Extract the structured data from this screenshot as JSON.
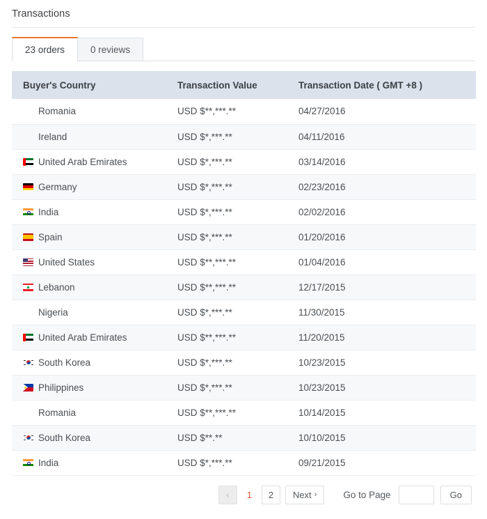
{
  "panel": {
    "title": "Transactions"
  },
  "tabs": [
    {
      "label": "23 orders",
      "active": true
    },
    {
      "label": "0 reviews",
      "active": false
    }
  ],
  "table": {
    "columns": [
      "Buyer's Country",
      "Transaction Value",
      "Transaction Date ( GMT +8 )"
    ],
    "rows": [
      {
        "flag": "ro",
        "country": "Romania",
        "value": "USD $**,***.**",
        "date": "04/27/2016"
      },
      {
        "flag": "ie",
        "country": "Ireland",
        "value": "USD $*,***.**",
        "date": "04/11/2016"
      },
      {
        "flag": "ae",
        "country": "United Arab Emirates",
        "value": "USD $*,***.**",
        "date": "03/14/2016"
      },
      {
        "flag": "de",
        "country": "Germany",
        "value": "USD $*,***.**",
        "date": "02/23/2016"
      },
      {
        "flag": "in",
        "country": "India",
        "value": "USD $*,***.**",
        "date": "02/02/2016"
      },
      {
        "flag": "es",
        "country": "Spain",
        "value": "USD $*,***.**",
        "date": "01/20/2016"
      },
      {
        "flag": "us",
        "country": "United States",
        "value": "USD $**,***.**",
        "date": "01/04/2016"
      },
      {
        "flag": "lb",
        "country": "Lebanon",
        "value": "USD $**,***.**",
        "date": "12/17/2015"
      },
      {
        "flag": "ng",
        "country": "Nigeria",
        "value": "USD $*,***.**",
        "date": "11/30/2015"
      },
      {
        "flag": "ae",
        "country": "United Arab Emirates",
        "value": "USD $**,***.**",
        "date": "11/20/2015"
      },
      {
        "flag": "kr",
        "country": "South Korea",
        "value": "USD $*,***.**",
        "date": "10/23/2015"
      },
      {
        "flag": "ph",
        "country": "Philippines",
        "value": "USD $*,***.**",
        "date": "10/23/2015"
      },
      {
        "flag": "ro",
        "country": "Romania",
        "value": "USD $**,***.**",
        "date": "10/14/2015"
      },
      {
        "flag": "kr",
        "country": "South Korea",
        "value": "USD $**.**",
        "date": "10/10/2015"
      },
      {
        "flag": "in",
        "country": "India",
        "value": "USD $*,***.**",
        "date": "09/21/2015"
      }
    ]
  },
  "pagination": {
    "prev_label": "‹",
    "pages": [
      "1",
      "2"
    ],
    "current_page": "1",
    "next_label": "Next",
    "next_chevron": "›",
    "goto_label": "Go to Page",
    "goto_value": "",
    "goto_placeholder": "",
    "go_label": "Go"
  },
  "colors": {
    "accent_orange": "#e8762a",
    "current_page_orange": "#e05a2b",
    "header_bg": "#dbe2ec",
    "row_alt_bg": "#f6f8fa"
  }
}
